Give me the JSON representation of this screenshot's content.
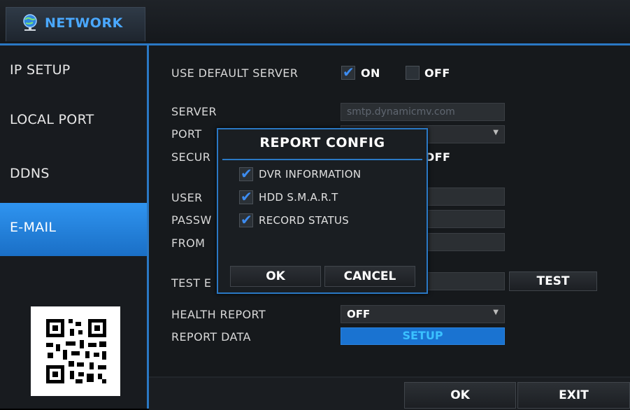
{
  "window": {
    "title": "NETWORK",
    "icon": "globe-network-icon"
  },
  "sidebar": {
    "items": [
      {
        "label": "IP SETUP",
        "active": false
      },
      {
        "label": "LOCAL PORT",
        "active": false
      },
      {
        "label": "DDNS",
        "active": false
      },
      {
        "label": "E-MAIL",
        "active": true
      }
    ]
  },
  "form": {
    "use_default_server": {
      "label": "USE DEFAULT SERVER",
      "on_label": "ON",
      "off_label": "OFF",
      "on_checked": true,
      "off_checked": false
    },
    "server": {
      "label": "SERVER",
      "value": "smtp.dynamicmv.com"
    },
    "port": {
      "label": "PORT"
    },
    "security": {
      "label": "SECUR",
      "tail": "DFF"
    },
    "user": {
      "label": "USER"
    },
    "password": {
      "label": "PASSW"
    },
    "from": {
      "label": "FROM"
    },
    "test_email": {
      "label": "TEST E",
      "button": "TEST"
    },
    "health_report": {
      "label": "HEALTH REPORT",
      "value": "OFF"
    },
    "report_data": {
      "label": "REPORT DATA",
      "button": "SETUP"
    }
  },
  "footer": {
    "ok": "OK",
    "exit": "EXIT"
  },
  "dialog": {
    "title": "REPORT CONFIG",
    "options": [
      {
        "label": "DVR INFORMATION",
        "checked": true
      },
      {
        "label": "HDD S.M.A.R.T",
        "checked": true
      },
      {
        "label": "RECORD STATUS",
        "checked": true
      }
    ],
    "ok": "OK",
    "cancel": "CANCEL"
  },
  "colors": {
    "accent": "#2a78c4",
    "active_tab": "#1f7fdc",
    "check": "#3d8cf0",
    "title_text": "#4aa8ff"
  }
}
